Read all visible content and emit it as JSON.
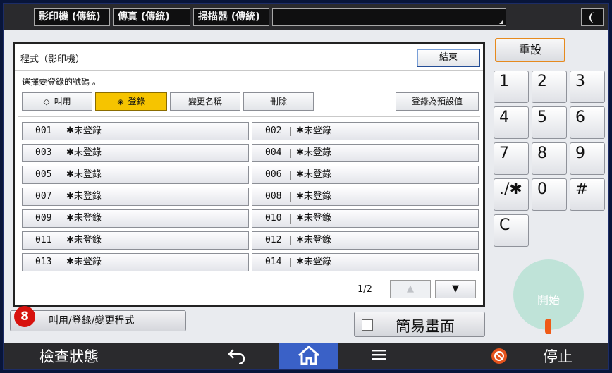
{
  "topbar": {
    "tabs": [
      "影印機 (傳統)",
      "傳真 (傳統)",
      "掃描器 (傳統)"
    ]
  },
  "dialog": {
    "title": "程式（影印機）",
    "end_label": "結束",
    "instruction": "選擇要登錄的號碼 。",
    "toolbar": {
      "recall": "叫用",
      "register": "登錄",
      "rename": "變更名稱",
      "delete": "刪除",
      "set_default": "登錄為預設值"
    },
    "slots": [
      {
        "num": "001",
        "label": "✱未登錄"
      },
      {
        "num": "002",
        "label": "✱未登錄"
      },
      {
        "num": "003",
        "label": "✱未登錄"
      },
      {
        "num": "004",
        "label": "✱未登錄"
      },
      {
        "num": "005",
        "label": "✱未登錄"
      },
      {
        "num": "006",
        "label": "✱未登錄"
      },
      {
        "num": "007",
        "label": "✱未登錄"
      },
      {
        "num": "008",
        "label": "✱未登錄"
      },
      {
        "num": "009",
        "label": "✱未登錄"
      },
      {
        "num": "010",
        "label": "✱未登錄"
      },
      {
        "num": "011",
        "label": "✱未登錄"
      },
      {
        "num": "012",
        "label": "✱未登錄"
      },
      {
        "num": "013",
        "label": "✱未登錄"
      },
      {
        "num": "014",
        "label": "✱未登錄"
      }
    ],
    "pager": {
      "text": "1/2",
      "up": "▲",
      "down": "▼"
    }
  },
  "program_button": {
    "badge": "8",
    "label": "叫用/登錄/變更程式"
  },
  "simple_screen_label": "簡易畫面",
  "keypad": {
    "reset": "重設",
    "keys": [
      "1",
      "2",
      "3",
      "4",
      "5",
      "6",
      "7",
      "8",
      "9",
      "./✱",
      "0",
      "#",
      "C"
    ],
    "start": "開始"
  },
  "bottombar": {
    "check_status": "檢查狀態",
    "stop": "停止"
  },
  "colors": {
    "accent_yellow": "#f6c400",
    "home_blue": "#3a61c7",
    "badge_red": "#d7120e",
    "reset_border": "#e68a1e",
    "start_green": "#bfe3d8"
  }
}
